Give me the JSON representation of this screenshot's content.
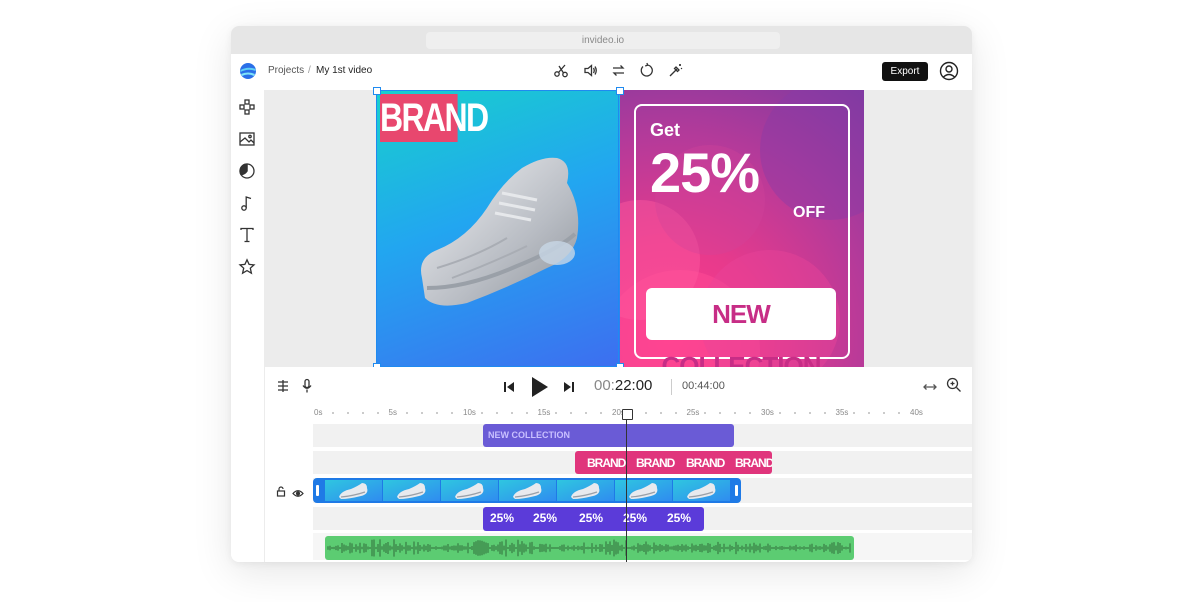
{
  "browser": {
    "url": "invideo.io"
  },
  "header": {
    "breadcrumb_root": "Projects",
    "breadcrumb_sep": "/",
    "project_title": "My 1st video",
    "export_label": "Export"
  },
  "canvas": {
    "brand_text": "BRAND",
    "promo_get": "Get",
    "promo_percent": "25%",
    "promo_off": "OFF",
    "promo_button": "NEW COLLECTION"
  },
  "player": {
    "current_time_dim": "00:",
    "current_time": "22:00",
    "total_time": "00:44:00"
  },
  "timeline": {
    "ruler": [
      "0s",
      "5s",
      "10s",
      "15s",
      "20s",
      "25s",
      "30s",
      "35s",
      "40s"
    ],
    "text_clip_label": "NEW COLLECTION",
    "brand_chips": [
      "BRAND",
      "BRAND",
      "BRAND",
      "BRAND"
    ],
    "percent_chips": [
      "25%",
      "25%",
      "25%",
      "25%",
      "25%"
    ]
  },
  "icons": {
    "header_tools": [
      "scissors-icon",
      "volume-icon",
      "swap-icon",
      "rotate-icon",
      "magic-wand-icon"
    ],
    "sidebar": [
      "elements-icon",
      "media-icon",
      "color-icon",
      "music-icon",
      "text-icon",
      "star-icon"
    ]
  },
  "colors": {
    "selection": "#1f8af0",
    "text_clip": "#6a5bd6",
    "brand_clip": "#e0357c",
    "video_clip": "#1f7ae6",
    "percent_clip": "#5b3bd9",
    "audio_clip": "#5ccc72"
  }
}
